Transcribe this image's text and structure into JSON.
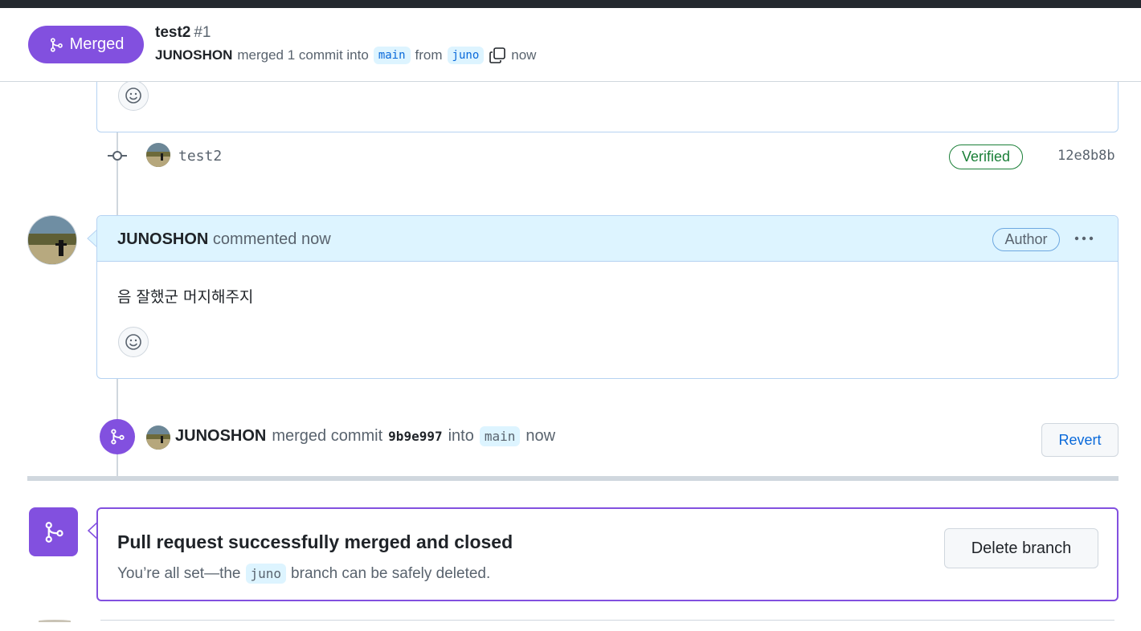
{
  "header": {
    "state_label": "Merged",
    "title": "test2",
    "number": "#1",
    "author": "JUNOSHON",
    "merged_text": "merged 1 commit into",
    "base_branch": "main",
    "from_text": "from",
    "head_branch": "juno",
    "time": "now"
  },
  "commit": {
    "message": "test2",
    "verified_label": "Verified",
    "sha": "12e8b8b"
  },
  "comment": {
    "author": "JUNOSHON",
    "action": "commented now",
    "author_badge": "Author",
    "body": "음 잘했군 머지해주지"
  },
  "merge_event": {
    "author": "JUNOSHON",
    "text1": "merged commit",
    "sha": "9b9e997",
    "text2": "into",
    "branch": "main",
    "time": "now",
    "revert_label": "Revert"
  },
  "merged_box": {
    "title": "Pull request successfully merged and closed",
    "desc_before": "You’re all set—the",
    "branch": "juno",
    "desc_after": "branch can be safely deleted.",
    "delete_label": "Delete branch"
  },
  "colors": {
    "merged": "#8250df",
    "link": "#0969da",
    "verified": "#1a7f37",
    "comment_header": "#ddf4ff"
  }
}
